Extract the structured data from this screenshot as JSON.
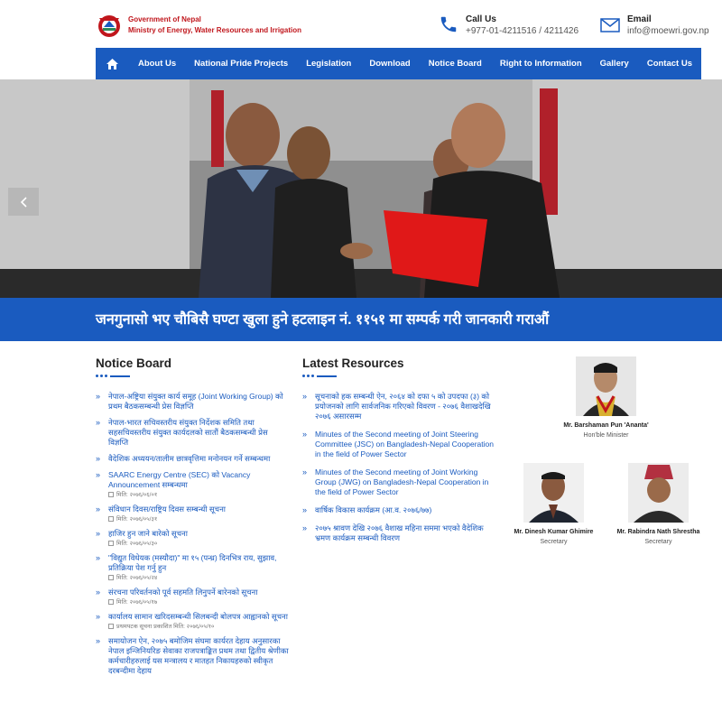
{
  "header": {
    "org_line1": "Government of Nepal",
    "org_line2": "Ministry of Energy, Water Resources and Irrigation",
    "call_title": "Call Us",
    "call_value": "+977-01-4211516 / 4211426",
    "email_title": "Email",
    "email_value": "info@moewri.gov.np"
  },
  "nav": {
    "items": [
      "About Us",
      "National Pride Projects",
      "Legislation",
      "Download",
      "Notice Board",
      "Right to Information",
      "Gallery",
      "Contact Us"
    ]
  },
  "hotline": "जनगुनासो भए चौबिसै घण्टा खुला हुने हटलाइन नं. ११५१ मा सम्पर्क गरी जानकारी गराऔं",
  "notice_board": {
    "title": "Notice Board",
    "items": [
      {
        "text": "नेपाल-अष्ट्रिया संयुक्त कार्य समूह (Joint Working Group) को प्रथम बैठकसम्बन्धी प्रेस विज्ञप्ति",
        "date": ""
      },
      {
        "text": "नेपाल-भारत सचिवस्तरीय संयुक्त निर्देशक समिति तथा सहसचिवस्तरीय संयुक्त कार्यदलको सातौं बैठकसम्बन्धी प्रेस विज्ञप्ति",
        "date": ""
      },
      {
        "text": "वैदेशिक अध्ययन/तालीम छात्रवृत्तिमा मनोनयन गर्ने सम्बन्धमा",
        "date": ""
      },
      {
        "text": "SAARC Energy Centre (SEC) को Vacancy Announcement सम्बन्धमा",
        "date": "मिति: २०७६/०६/०१"
      },
      {
        "text": "संविधान दिवस/राष्ट्रिय दिवस सम्बन्धी सूचना",
        "date": "मिति: २०७६/०५/३१"
      },
      {
        "text": "हाजिर हुन जाने बारेको सूचना",
        "date": "मिति: २०७६/०५/३०"
      },
      {
        "text": "\"विद्युत विधेयक (मस्यौदा)\" मा १५ (पन्ध्र) दिनभित्र राय, सुझाव, प्रतिक्रिया पेश गर्नु हुन",
        "date": "मिति: २०७६/०५/२४"
      },
      {
        "text": "संरचना परिवर्तनको पूर्व सहमति लिनुपर्ने बारेनको सूचना",
        "date": "मिति: २०७६/०५/१७"
      },
      {
        "text": "कार्यालय सामान खरिदसम्बन्धी सिलबन्दी बोलपत्र आह्वानको सूचना",
        "date": "प्रथमपटक सूचना प्रकाशित मिति: २०७६/०५/१०"
      },
      {
        "text": "समायोजन ऐन, २०७५ बमोजिम संघमा कार्यरत देहाय अनुसारका नेपाल इन्जिनियरिङ सेवाका राजपत्राङ्कित प्रथम तथा द्वितीय श्रेणीका कर्मचारीहरुलाई यस मन्त्रालय र मातहत निकायहरुको स्वीकृत दरबन्दीमा देहाय",
        "date": ""
      }
    ]
  },
  "latest_resources": {
    "title": "Latest Resources",
    "items": [
      {
        "text": "सूचनाको हक सम्बन्धी ऐन, २०६४ को दफा ५ को उपदफा (३) को प्रयोजनको लागि सार्वजनिक गरिएको विवरण - २०७६ वैशाखदेखि २०७६ असारसम्म"
      },
      {
        "text": "Minutes of the Second meeting of Joint Steering Committee (JSC) on Bangladesh-Nepal Cooperation in the field of Power Sector"
      },
      {
        "text": "Minutes of the Second meeting of Joint Working Group (JWG) on Bangladesh-Nepal Cooperation in the field of Power Sector"
      },
      {
        "text": "वार्षिक विकास कार्यक्रम (आ.व. २०७६/७७)"
      },
      {
        "text": "२०७५ श्रावण देखि २०७६ वैशाख महिना सममा भएको वैदेशिक भ्रमण कार्यक्रम सम्बन्धी विवरण"
      }
    ]
  },
  "officials": [
    {
      "name": "Mr. Barshaman Pun 'Ananta'",
      "role": "Hon'ble Minister"
    },
    {
      "name": "Mr. Dinesh Kumar Ghimire",
      "role": "Secretary"
    },
    {
      "name": "Mr. Rabindra Nath Shrestha",
      "role": "Secretary"
    }
  ],
  "icons": {
    "home": "home-icon",
    "phone": "phone-icon",
    "mail": "mail-icon",
    "prev": "chevron-left-icon",
    "bullet": "double-chevron-icon"
  },
  "colors": {
    "brand_blue": "#1a5bbf",
    "brand_red": "#c0161c"
  }
}
